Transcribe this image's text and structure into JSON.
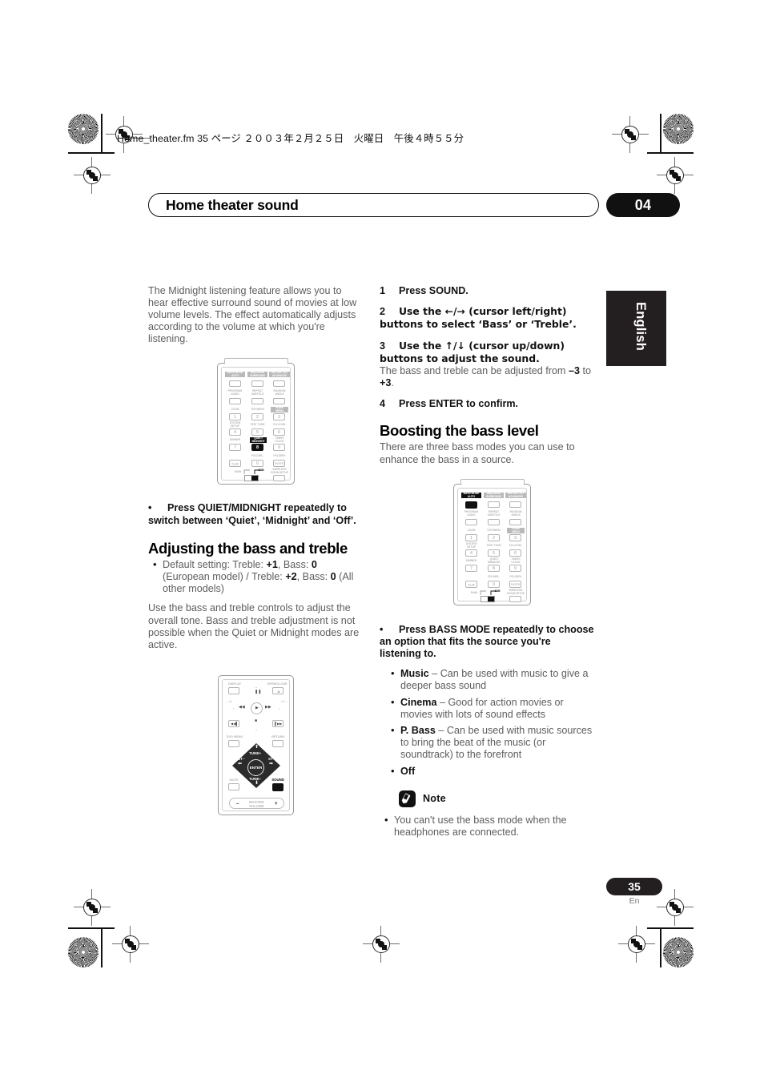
{
  "header": {
    "filename_line": "Home_theater.fm  35 ページ  ２００３年２月２５日　火曜日　午後４時５５分",
    "chapter_title": "Home theater sound",
    "chapter_number": "04",
    "language_tab": "English"
  },
  "footer": {
    "page_number": "35",
    "page_lang": "En"
  },
  "left_column": {
    "intro": "The Midnight listening feature allows you to hear effective surround sound of movies at low volume levels. The effect automatically adjusts according to the volume at which you're listening.",
    "quiet_instruction_bullet": "•",
    "quiet_instruction": "Press QUIET/MIDNIGHT repeatedly to switch between ‘Quiet’, ‘Midnight’ and ‘Off’.",
    "section_title": "Adjusting the bass and treble",
    "default_setting_prefix": "Default setting: Treble: ",
    "default_treble_eu": "+1",
    "default_bass_sep": ", Bass: ",
    "default_bass_eu": "0",
    "default_setting_mid": " (European model) / Treble: ",
    "default_treble_other": "+2",
    "default_bass_other": "0",
    "default_setting_suffix": " (All other models)",
    "usage_note": "Use the bass and treble controls to adjust the overall tone. Bass and treble adjustment is not possible when the Quiet or Midnight modes are active."
  },
  "right_column": {
    "steps": [
      {
        "num": "1",
        "text": "Press SOUND."
      },
      {
        "num": "2",
        "text": "Use the ←/→ (cursor left/right) buttons to select ‘Bass’ or ‘Treble’."
      },
      {
        "num": "3",
        "text": "Use the ↑/↓ (cursor up/down) buttons to adjust the sound."
      },
      {
        "num": "4",
        "text": "Press ENTER to confirm."
      }
    ],
    "step3_note_prefix": "The bass and treble can be adjusted from ",
    "step3_note_min": "–3",
    "step3_note_mid": " to ",
    "step3_note_max": "+3",
    "step3_note_suffix": ".",
    "section_title": "Boosting the bass level",
    "section_intro": "There are three bass modes you can use to enhance the bass in a source.",
    "bass_mode_bullet": "•",
    "bass_mode_instruction": "Press BASS MODE repeatedly to choose an option that fits the source you're listening to.",
    "modes": [
      {
        "name": "Music",
        "desc": " – Can be used with music to give a deeper bass sound"
      },
      {
        "name": "Cinema",
        "desc": " – Good for action movies or movies with lots of sound effects"
      },
      {
        "name": "P. Bass",
        "desc": " – Can be used with music sources to bring the beat of the music (or soundtrack) to the forefront"
      },
      {
        "name": "Off",
        "desc": ""
      }
    ],
    "note_label": "Note",
    "note_text": "You can't use the bass mode when the headphones are connected."
  },
  "remote_numeric": {
    "top_row": [
      {
        "line1": "BASS MODE",
        "line2": "AUTO"
      },
      {
        "line1": "DIALOGUE",
        "line2": "SURROUND"
      },
      {
        "line1": "VIRTUAL SST",
        "line2": "ADVANCED"
      }
    ],
    "second_row": [
      {
        "line1": "PROGRAM",
        "line2": "AUDIO"
      },
      {
        "line1": "REPEAT",
        "line2": "SUBTITLE"
      },
      {
        "line1": "RANDOM",
        "line2": "ANGLE"
      }
    ],
    "keys": [
      {
        "label": "ZOOM",
        "num": "1"
      },
      {
        "label": "TOP MENU",
        "num": "2"
      },
      {
        "label": "HOME MENU",
        "num": "3"
      },
      {
        "label": "SYSTEM SETUP",
        "num": "4"
      },
      {
        "label": "TEST TONE",
        "num": "5"
      },
      {
        "label": "CH LEVEL",
        "num": "6"
      },
      {
        "label": "DIMMER",
        "num": "7"
      },
      {
        "label": "QUIET/ MIDNIGHT",
        "num": "8"
      },
      {
        "label": "TIMER/ CLOCK",
        "num": "9"
      },
      {
        "label": "CLR",
        "num": ""
      },
      {
        "label": "FOLDER–",
        "num": "0"
      },
      {
        "label": "FOLDER+",
        "num": "ENTER"
      }
    ],
    "bottom": {
      "main": "MAIN",
      "sub": "SUB",
      "wireless": "WIRELESS ROOM SETUP"
    }
  },
  "remote_dvd": {
    "display": "DISPLAY",
    "open_close": "OPEN/CLOSE",
    "dvd_menu": "DVD MENU",
    "return": "RETURN",
    "mute": "MUTE",
    "sound": "SOUND",
    "tune_up": "TUNE+",
    "tune_down": "TUNE–",
    "st_minus": "ST–",
    "st_plus": "ST+",
    "enter": "ENTER",
    "master_volume_1": "MASTER",
    "master_volume_2": "VOLUME",
    "vol_minus": "–",
    "vol_plus": "+",
    "skip_left": "←‹/‹‹",
    "skip_right": "››/›→"
  },
  "colors": {
    "ink": "#111111",
    "body_grey": "#5d5d5d",
    "art_grey": "#b6b6b6",
    "tab_black": "#231f20"
  }
}
